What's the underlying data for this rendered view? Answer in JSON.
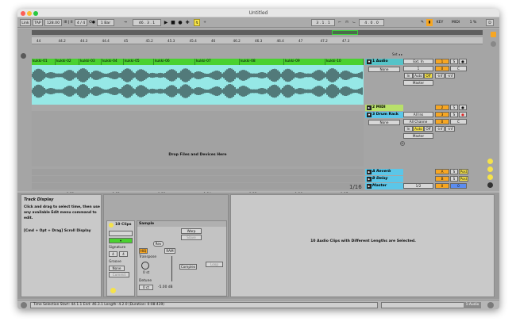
{
  "window": {
    "title": "Untitled"
  },
  "control_bar": {
    "link": "Link",
    "tap": "TAP",
    "tempo": "128.00",
    "tempo_marks": "III | II",
    "time_sig": "4 / 4",
    "metro": "O●",
    "quantize": "1 Bar",
    "position": "46 . 3 . 1",
    "loop_start": "3 . 1 . 1",
    "loop_length": "4 . 0 . 0",
    "key": "KEY",
    "midi": "MIDI",
    "cpu": "1 %",
    "d": "D"
  },
  "ruler": {
    "top": [
      "44",
      "44.2",
      "44.3",
      "44.4",
      "45",
      "45.2",
      "45.3",
      "45.4",
      "46",
      "46.2",
      "46.3",
      "46.4",
      "47",
      "47.2",
      "47.3"
    ],
    "bottom": [
      "1:21",
      "1:22",
      "1:23",
      "1:24",
      "1:25",
      "1:26",
      "1:27"
    ]
  },
  "clips": [
    "kukki-01",
    "kukki-02",
    "kukki-03",
    "kukki-04",
    "kukki-05",
    "kukki-06",
    "kukki-07",
    "kukki-08",
    "kukki-09",
    "kukki-10"
  ],
  "tracks": {
    "audio": "1 Audio",
    "midi": "2 MIDI",
    "drum": "3 Drum Rack",
    "rev": "A Reverb",
    "del": "B Delay",
    "master": "Master"
  },
  "mixer": {
    "none": "None",
    "ext_in": "Ext. In",
    "ch1": "1",
    "in": "In",
    "auto": "Auto",
    "off": "Off",
    "master": "Master",
    "inf": "-inf",
    "all_ins": "All Ins",
    "all_channels": "All Channe",
    "num1": "1",
    "num2": "2",
    "num3": "3",
    "a": "A",
    "b": "B",
    "s": "S",
    "c": "C",
    "post": "Post",
    "ratio": "1/2",
    "set": "Set",
    "drop": "Drop Files and Devices Here",
    "sixteenth": "1/16",
    "time_in_view": "0"
  },
  "info": {
    "title": "Track Display",
    "body": "Click and drag to select time, then use any available Edit menu command to edit.",
    "shortcut": "[Cmd + Opt + Drag] Scroll Display"
  },
  "clip_view": {
    "clips": "10 Clips",
    "sample": "Sample",
    "signature": "Signature",
    "sig_num": "4",
    "sig_den": "4",
    "groove": "Groove",
    "groove_val": "None",
    "commit": "Commit",
    "warp": "Warp",
    "slave": "Slave",
    "hq": "HiQ",
    "ram": "RAM",
    "rev_btn": "Rev",
    "transpose": "Transpose",
    "st": "0 st",
    "detune": "Detune",
    "ct": "0 ct",
    "db": "-5.00 dB",
    "complex": "Complex",
    "loop": "Loop",
    "message": "10 Audio Clips with Different Lengths are Selected."
  },
  "status": {
    "text": "Time Selection  Start: 44.1.1   End: 46.3.1   Length: 4.2.0  (Duration: 0:08:439)",
    "track": "1-Audio"
  },
  "colors": {
    "clip": "#4ad130",
    "wave_bg": "#8fe8e8",
    "audio_track": "#55c3c8",
    "midi_track": "#b8e06a",
    "return": "#5bc6e8",
    "orange": "#f6a623",
    "yellow": "#f5e24a"
  }
}
